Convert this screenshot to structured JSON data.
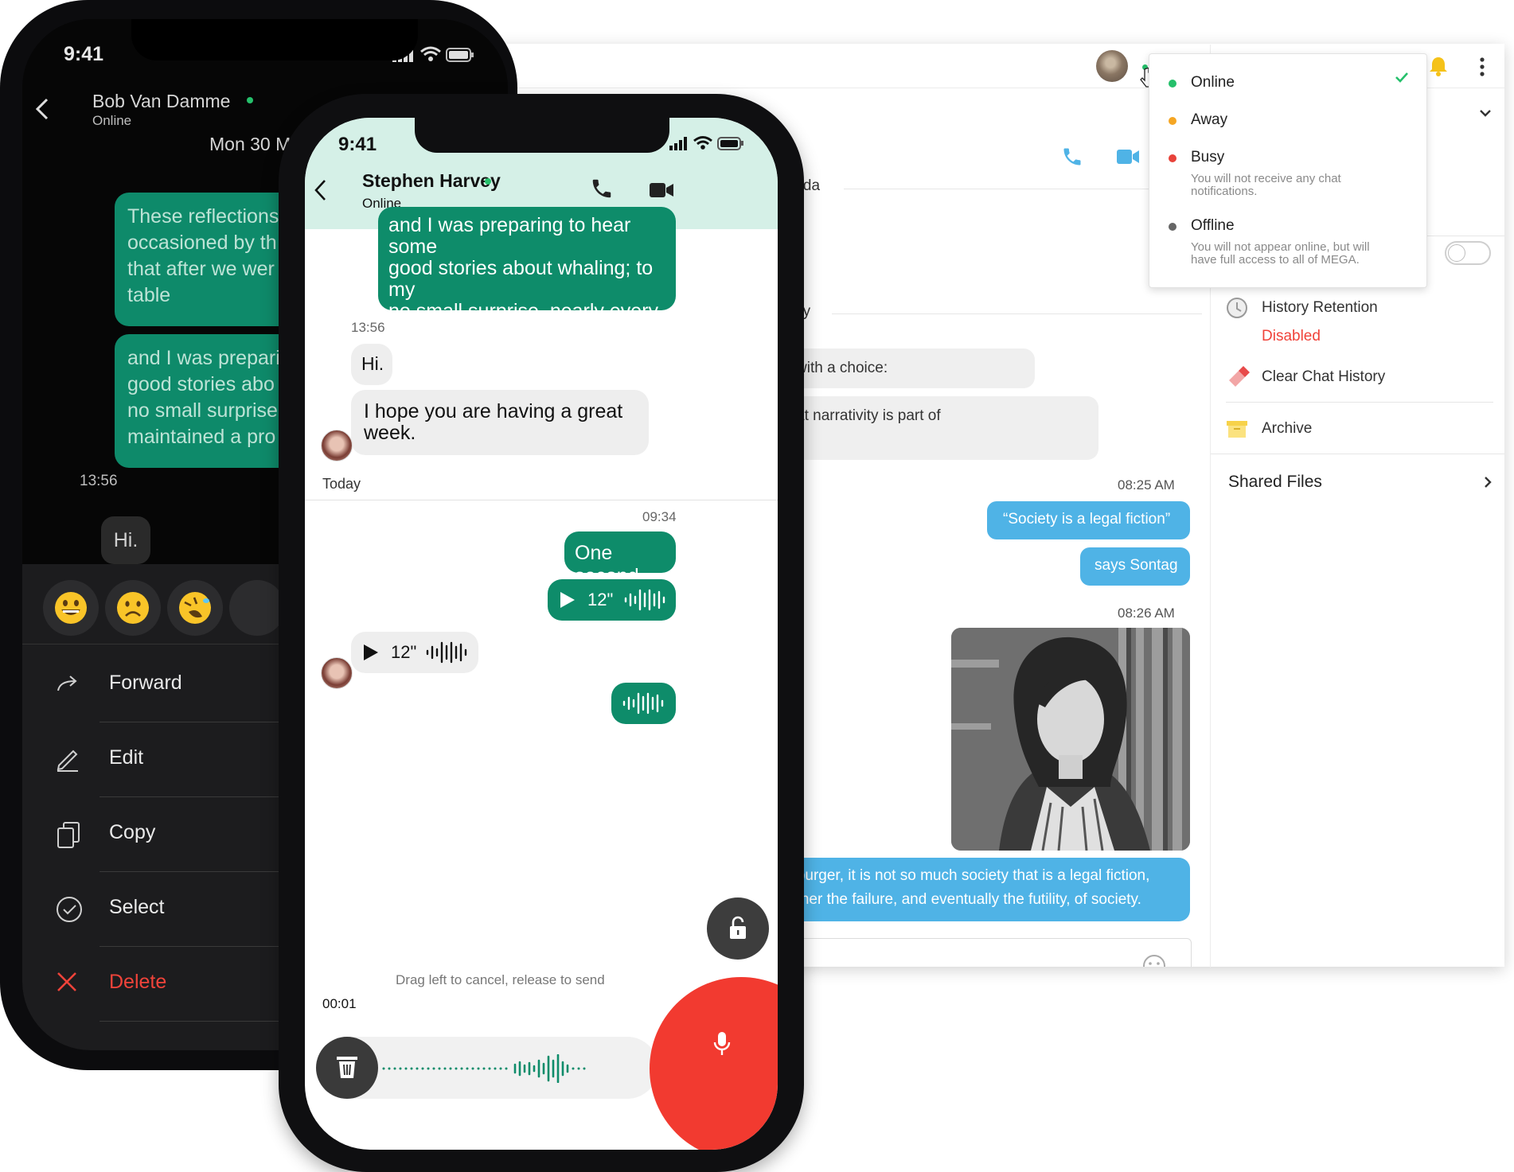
{
  "desktop": {
    "partial_name": "erda",
    "day_label_partial": "ay",
    "msg_in_1": "with a choice:",
    "msg_in_2": "at narrativity is part of",
    "time_1": "08:25 AM",
    "msg_out_1": "“Society is a legal fiction”",
    "msg_out_2": "says Sontag",
    "time_2": "08:26 AM",
    "msg_out_3_line1": "mburger, it is not so much society that is a legal fiction,",
    "msg_out_3_line2": "ather the failure, and eventually the futility, of society.",
    "right_panel": {
      "history_retention": "History Retention",
      "history_status": "Disabled",
      "clear_history": "Clear Chat History",
      "archive": "Archive",
      "shared_files": "Shared Files"
    },
    "status_menu": {
      "online": "Online",
      "away": "Away",
      "busy": "Busy",
      "busy_desc": "You will not receive any chat notifications.",
      "offline": "Offline",
      "offline_desc": "You will not appear online, but will have full access to all of MEGA."
    },
    "colors": {
      "online": "#25c06b",
      "away": "#f5a623",
      "busy": "#e8423a",
      "offline": "#666666",
      "outgoing": "#4fb3e6",
      "disabled": "#f0433a"
    }
  },
  "back_phone": {
    "time": "9:41",
    "contact_name": "Bob Van Damme",
    "contact_status": "Online",
    "date_label": "Mon 30 M",
    "bubble_1": "These reflections\noccasioned by th\nthat after we wer\ntable",
    "bubble_2": "and I was prepari\ngood stories abo\nno small surprise\nmaintained a pro",
    "time_msg": "13:56",
    "hi": "Hi.",
    "actions": {
      "forward": "Forward",
      "edit": "Edit",
      "copy": "Copy",
      "select": "Select",
      "delete": "Delete"
    }
  },
  "front_phone": {
    "time": "9:41",
    "contact_name": "Stephen Harvey",
    "contact_status": "Online",
    "bubble_top": "and I was preparing to hear some\ngood stories about whaling; to my\nno small surprise, nearly every man\nmaintained a profound silence.",
    "time_1": "13:56",
    "hi": "Hi.",
    "msg_in_2": "I hope you are having a great\nweek.",
    "today": "Today",
    "time_2": "09:34",
    "one_second": "One second",
    "voice_duration": "12\"",
    "voice_in_duration": "12\"",
    "hint": "Drag left to cancel, release to send",
    "recording_time": "00:01"
  }
}
